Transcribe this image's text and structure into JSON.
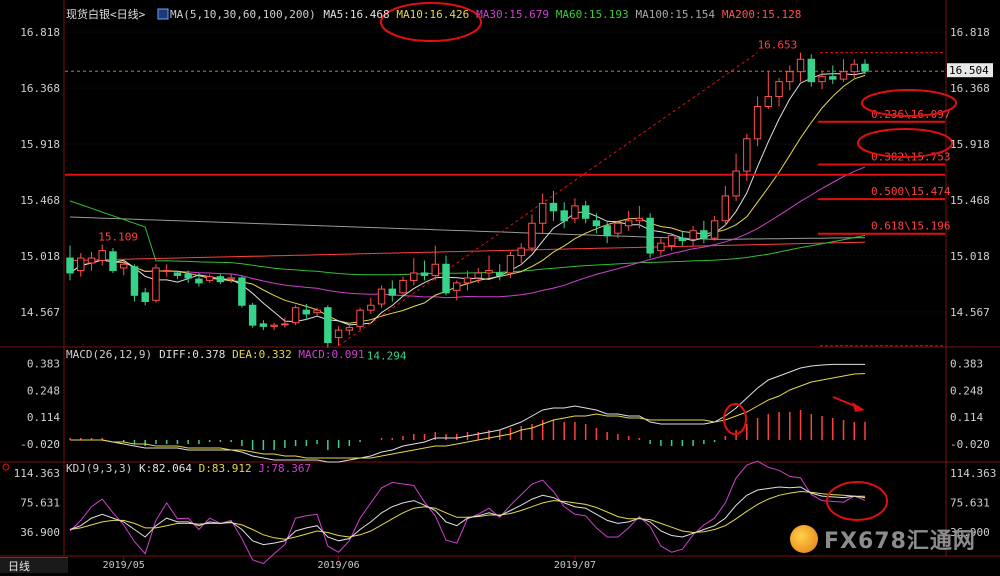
{
  "top_label": "现货白银<日线>",
  "ma_legend": [
    {
      "label": "MA(5,10,30,60,100,200)",
      "color": "#d0d0d0"
    },
    {
      "label": "MA5:16.468",
      "color": "#e0e0e0"
    },
    {
      "label": "MA10:16.426",
      "color": "#e6d84a"
    },
    {
      "label": "MA30:15.679",
      "color": "#d040d0"
    },
    {
      "label": "MA60:15.193",
      "color": "#3ccc3c"
    },
    {
      "label": "MA100:15.154",
      "color": "#a8a8a8"
    },
    {
      "label": "MA200:15.128",
      "color": "#ff5050"
    }
  ],
  "macd_legend": [
    {
      "label": "MACD(26,12,9)",
      "color": "#d0d0d0"
    },
    {
      "label": "DIFF:0.378",
      "color": "#e0e0e0"
    },
    {
      "label": "DEA:0.332",
      "color": "#e6d84a"
    },
    {
      "label": "MACD:0.091",
      "color": "#d040d0"
    }
  ],
  "kdj_legend": [
    {
      "label": "KDJ(9,3,3)",
      "color": "#d0d0d0"
    },
    {
      "label": "K:82.064",
      "color": "#e0e0e0"
    },
    {
      "label": "D:83.912",
      "color": "#e6d84a"
    },
    {
      "label": "J:78.367",
      "color": "#d040d0"
    }
  ],
  "bottom_tab": "日线",
  "watermark": "FX678汇通网",
  "chart_data": [
    {
      "type": "candlestick",
      "name": "price",
      "ylim": [
        14.3,
        16.9
      ],
      "y_ticks": [
        "16.818",
        "16.368",
        "15.918",
        "15.468",
        "15.018",
        "14.567"
      ],
      "y_tick_values": [
        16.818,
        16.368,
        15.918,
        15.468,
        15.018,
        14.567
      ],
      "x_ticks": [
        "2019/05",
        "2019/06",
        "2019/07"
      ],
      "x_tick_index": [
        5,
        25,
        47
      ],
      "annotations": [
        {
          "text": "16.653",
          "x": 64,
          "y": 16.653
        },
        {
          "text": "15.109",
          "x": 3,
          "y": 15.109
        },
        {
          "text": "14.294",
          "x": 28,
          "y": 14.294
        }
      ],
      "current_price": "16.504",
      "current_price_value": 16.504,
      "fibonacci": [
        {
          "label": "0.236\\16.097",
          "value": 16.097
        },
        {
          "label": "0.382\\15.753",
          "value": 15.753
        },
        {
          "label": "0.500\\15.474",
          "value": 15.474
        },
        {
          "label": "0.618\\15.196",
          "value": 15.196
        }
      ],
      "horizontal_lines": [
        15.67
      ],
      "candles": [
        {
          "o": 15.0,
          "h": 15.1,
          "l": 14.82,
          "c": 14.88
        },
        {
          "o": 14.9,
          "h": 15.04,
          "l": 14.85,
          "c": 15.0
        },
        {
          "o": 14.96,
          "h": 15.05,
          "l": 14.9,
          "c": 15.0
        },
        {
          "o": 14.98,
          "h": 15.109,
          "l": 14.94,
          "c": 15.06
        },
        {
          "o": 15.05,
          "h": 15.08,
          "l": 14.88,
          "c": 14.9
        },
        {
          "o": 14.92,
          "h": 14.98,
          "l": 14.86,
          "c": 14.95
        },
        {
          "o": 14.93,
          "h": 14.95,
          "l": 14.65,
          "c": 14.7
        },
        {
          "o": 14.72,
          "h": 14.76,
          "l": 14.62,
          "c": 14.65
        },
        {
          "o": 14.66,
          "h": 14.95,
          "l": 14.64,
          "c": 14.92
        },
        {
          "o": 14.9,
          "h": 14.95,
          "l": 14.85,
          "c": 14.9
        },
        {
          "o": 14.88,
          "h": 14.9,
          "l": 14.83,
          "c": 14.86
        },
        {
          "o": 14.87,
          "h": 14.9,
          "l": 14.8,
          "c": 14.84
        },
        {
          "o": 14.83,
          "h": 14.88,
          "l": 14.77,
          "c": 14.8
        },
        {
          "o": 14.82,
          "h": 14.87,
          "l": 14.8,
          "c": 14.85
        },
        {
          "o": 14.85,
          "h": 14.87,
          "l": 14.79,
          "c": 14.81
        },
        {
          "o": 14.83,
          "h": 14.87,
          "l": 14.8,
          "c": 14.84
        },
        {
          "o": 14.84,
          "h": 14.86,
          "l": 14.6,
          "c": 14.62
        },
        {
          "o": 14.62,
          "h": 14.64,
          "l": 14.44,
          "c": 14.46
        },
        {
          "o": 14.47,
          "h": 14.5,
          "l": 14.42,
          "c": 14.45
        },
        {
          "o": 14.45,
          "h": 14.48,
          "l": 14.42,
          "c": 14.46
        },
        {
          "o": 14.47,
          "h": 14.52,
          "l": 14.44,
          "c": 14.47
        },
        {
          "o": 14.48,
          "h": 14.62,
          "l": 14.46,
          "c": 14.6
        },
        {
          "o": 14.58,
          "h": 14.63,
          "l": 14.5,
          "c": 14.55
        },
        {
          "o": 14.56,
          "h": 14.6,
          "l": 14.53,
          "c": 14.58
        },
        {
          "o": 14.6,
          "h": 14.62,
          "l": 14.28,
          "c": 14.32
        },
        {
          "o": 14.36,
          "h": 14.45,
          "l": 14.294,
          "c": 14.42
        },
        {
          "o": 14.42,
          "h": 14.48,
          "l": 14.38,
          "c": 14.44
        },
        {
          "o": 14.45,
          "h": 14.6,
          "l": 14.42,
          "c": 14.58
        },
        {
          "o": 14.58,
          "h": 14.68,
          "l": 14.55,
          "c": 14.62
        },
        {
          "o": 14.63,
          "h": 14.78,
          "l": 14.6,
          "c": 14.75
        },
        {
          "o": 14.75,
          "h": 14.82,
          "l": 14.65,
          "c": 14.7
        },
        {
          "o": 14.72,
          "h": 14.85,
          "l": 14.7,
          "c": 14.82
        },
        {
          "o": 14.82,
          "h": 15.0,
          "l": 14.78,
          "c": 14.88
        },
        {
          "o": 14.88,
          "h": 14.98,
          "l": 14.82,
          "c": 14.86
        },
        {
          "o": 14.86,
          "h": 15.1,
          "l": 14.82,
          "c": 14.95
        },
        {
          "o": 14.95,
          "h": 15.02,
          "l": 14.7,
          "c": 14.72
        },
        {
          "o": 14.74,
          "h": 14.82,
          "l": 14.66,
          "c": 14.8
        },
        {
          "o": 14.8,
          "h": 14.9,
          "l": 14.74,
          "c": 14.84
        },
        {
          "o": 14.84,
          "h": 14.92,
          "l": 14.8,
          "c": 14.88
        },
        {
          "o": 14.88,
          "h": 15.02,
          "l": 14.84,
          "c": 14.9
        },
        {
          "o": 14.88,
          "h": 14.95,
          "l": 14.82,
          "c": 14.86
        },
        {
          "o": 14.88,
          "h": 15.05,
          "l": 14.84,
          "c": 15.02
        },
        {
          "o": 15.02,
          "h": 15.12,
          "l": 14.96,
          "c": 15.08
        },
        {
          "o": 15.08,
          "h": 15.35,
          "l": 15.05,
          "c": 15.28
        },
        {
          "o": 15.28,
          "h": 15.52,
          "l": 15.2,
          "c": 15.44
        },
        {
          "o": 15.44,
          "h": 15.54,
          "l": 15.3,
          "c": 15.38
        },
        {
          "o": 15.38,
          "h": 15.45,
          "l": 15.24,
          "c": 15.3
        },
        {
          "o": 15.32,
          "h": 15.48,
          "l": 15.28,
          "c": 15.42
        },
        {
          "o": 15.42,
          "h": 15.46,
          "l": 15.28,
          "c": 15.32
        },
        {
          "o": 15.3,
          "h": 15.36,
          "l": 15.2,
          "c": 15.26
        },
        {
          "o": 15.26,
          "h": 15.3,
          "l": 15.12,
          "c": 15.18
        },
        {
          "o": 15.2,
          "h": 15.3,
          "l": 15.16,
          "c": 15.28
        },
        {
          "o": 15.26,
          "h": 15.38,
          "l": 15.22,
          "c": 15.3
        },
        {
          "o": 15.3,
          "h": 15.42,
          "l": 15.24,
          "c": 15.32
        },
        {
          "o": 15.32,
          "h": 15.36,
          "l": 15.0,
          "c": 15.04
        },
        {
          "o": 15.06,
          "h": 15.16,
          "l": 15.02,
          "c": 15.12
        },
        {
          "o": 15.1,
          "h": 15.2,
          "l": 15.06,
          "c": 15.18
        },
        {
          "o": 15.16,
          "h": 15.22,
          "l": 15.1,
          "c": 15.14
        },
        {
          "o": 15.15,
          "h": 15.26,
          "l": 15.1,
          "c": 15.22
        },
        {
          "o": 15.22,
          "h": 15.3,
          "l": 15.12,
          "c": 15.16
        },
        {
          "o": 15.16,
          "h": 15.34,
          "l": 15.14,
          "c": 15.3
        },
        {
          "o": 15.3,
          "h": 15.58,
          "l": 15.26,
          "c": 15.5
        },
        {
          "o": 15.5,
          "h": 15.84,
          "l": 15.46,
          "c": 15.7
        },
        {
          "o": 15.7,
          "h": 16.0,
          "l": 15.62,
          "c": 15.96
        },
        {
          "o": 15.96,
          "h": 16.3,
          "l": 15.9,
          "c": 16.22
        },
        {
          "o": 16.22,
          "h": 16.5,
          "l": 16.2,
          "c": 16.3
        },
        {
          "o": 16.3,
          "h": 16.45,
          "l": 16.22,
          "c": 16.42
        },
        {
          "o": 16.42,
          "h": 16.55,
          "l": 16.35,
          "c": 16.5
        },
        {
          "o": 16.5,
          "h": 16.653,
          "l": 16.42,
          "c": 16.6
        },
        {
          "o": 16.6,
          "h": 16.64,
          "l": 16.38,
          "c": 16.42
        },
        {
          "o": 16.42,
          "h": 16.5,
          "l": 16.36,
          "c": 16.46
        },
        {
          "o": 16.46,
          "h": 16.55,
          "l": 16.4,
          "c": 16.44
        },
        {
          "o": 16.44,
          "h": 16.6,
          "l": 16.42,
          "c": 16.5
        },
        {
          "o": 16.5,
          "h": 16.6,
          "l": 16.45,
          "c": 16.56
        },
        {
          "o": 16.56,
          "h": 16.6,
          "l": 16.48,
          "c": 16.504
        }
      ]
    },
    {
      "type": "macd",
      "name": "MACD",
      "ylim": [
        -0.1,
        0.45
      ],
      "y_ticks": [
        "0.383",
        "0.248",
        "0.114",
        "-0.020"
      ],
      "y_tick_values": [
        0.383,
        0.248,
        0.114,
        -0.02
      ],
      "hist": [
        0.01,
        0.01,
        0.01,
        0.01,
        0.0,
        -0.01,
        -0.02,
        -0.03,
        -0.02,
        -0.02,
        -0.02,
        -0.02,
        -0.02,
        -0.01,
        -0.01,
        -0.01,
        -0.03,
        -0.05,
        -0.05,
        -0.05,
        -0.04,
        -0.03,
        -0.03,
        -0.02,
        -0.05,
        -0.04,
        -0.03,
        -0.01,
        0.0,
        0.01,
        0.01,
        0.02,
        0.03,
        0.03,
        0.04,
        0.03,
        0.03,
        0.04,
        0.04,
        0.05,
        0.05,
        0.06,
        0.07,
        0.08,
        0.1,
        0.1,
        0.09,
        0.09,
        0.08,
        0.06,
        0.04,
        0.03,
        0.02,
        0.01,
        -0.02,
        -0.03,
        -0.03,
        -0.03,
        -0.03,
        -0.02,
        -0.01,
        0.02,
        0.05,
        0.08,
        0.11,
        0.13,
        0.14,
        0.14,
        0.15,
        0.13,
        0.12,
        0.11,
        0.1,
        0.09,
        0.091
      ],
      "diff": [
        0.0,
        0.0,
        0.0,
        0.0,
        -0.01,
        -0.02,
        -0.03,
        -0.04,
        -0.04,
        -0.04,
        -0.04,
        -0.05,
        -0.05,
        -0.05,
        -0.05,
        -0.05,
        -0.06,
        -0.08,
        -0.09,
        -0.1,
        -0.1,
        -0.1,
        -0.1,
        -0.1,
        -0.11,
        -0.11,
        -0.1,
        -0.09,
        -0.08,
        -0.06,
        -0.05,
        -0.03,
        -0.02,
        -0.01,
        0.01,
        0.01,
        0.01,
        0.02,
        0.03,
        0.04,
        0.05,
        0.07,
        0.09,
        0.12,
        0.15,
        0.16,
        0.16,
        0.17,
        0.16,
        0.15,
        0.13,
        0.13,
        0.12,
        0.12,
        0.09,
        0.08,
        0.08,
        0.08,
        0.08,
        0.08,
        0.09,
        0.12,
        0.16,
        0.21,
        0.26,
        0.3,
        0.32,
        0.34,
        0.36,
        0.37,
        0.375,
        0.378,
        0.378,
        0.378,
        0.378
      ],
      "dea": [
        0.0,
        0.0,
        0.0,
        0.0,
        -0.01,
        -0.01,
        -0.02,
        -0.02,
        -0.03,
        -0.03,
        -0.03,
        -0.04,
        -0.04,
        -0.04,
        -0.04,
        -0.05,
        -0.05,
        -0.06,
        -0.07,
        -0.07,
        -0.08,
        -0.08,
        -0.09,
        -0.09,
        -0.09,
        -0.09,
        -0.09,
        -0.09,
        -0.09,
        -0.08,
        -0.07,
        -0.06,
        -0.05,
        -0.04,
        -0.03,
        -0.03,
        -0.02,
        -0.01,
        0.0,
        0.01,
        0.02,
        0.03,
        0.05,
        0.06,
        0.08,
        0.1,
        0.11,
        0.12,
        0.12,
        0.13,
        0.12,
        0.12,
        0.11,
        0.11,
        0.1,
        0.1,
        0.1,
        0.1,
        0.1,
        0.1,
        0.09,
        0.1,
        0.12,
        0.14,
        0.17,
        0.2,
        0.22,
        0.25,
        0.27,
        0.29,
        0.3,
        0.31,
        0.32,
        0.33,
        0.332
      ]
    },
    {
      "type": "kdj",
      "name": "KDJ",
      "ylim": [
        5,
        125
      ],
      "y_ticks": [
        "114.363",
        "75.631",
        "36.900"
      ],
      "y_tick_values": [
        114.363,
        75.631,
        36.9
      ],
      "k": [
        40,
        45,
        55,
        60,
        55,
        50,
        40,
        30,
        45,
        55,
        50,
        50,
        45,
        50,
        48,
        50,
        40,
        25,
        20,
        22,
        25,
        38,
        42,
        45,
        30,
        25,
        28,
        40,
        50,
        62,
        70,
        75,
        78,
        72,
        65,
        50,
        45,
        55,
        58,
        62,
        58,
        65,
        72,
        80,
        85,
        82,
        75,
        70,
        68,
        60,
        52,
        48,
        50,
        55,
        50,
        38,
        32,
        30,
        35,
        40,
        45,
        55,
        72,
        85,
        92,
        94,
        96,
        95,
        96,
        88,
        84,
        83,
        82,
        84,
        82
      ],
      "d": [
        40,
        42,
        46,
        50,
        52,
        52,
        48,
        42,
        42,
        45,
        48,
        48,
        47,
        48,
        48,
        49,
        46,
        40,
        33,
        29,
        27,
        30,
        34,
        38,
        36,
        32,
        30,
        33,
        38,
        46,
        54,
        62,
        68,
        70,
        68,
        62,
        56,
        56,
        57,
        59,
        59,
        61,
        65,
        70,
        75,
        78,
        77,
        75,
        73,
        69,
        63,
        57,
        54,
        54,
        53,
        48,
        43,
        38,
        36,
        37,
        40,
        45,
        54,
        64,
        73,
        80,
        85,
        88,
        90,
        89,
        87,
        86,
        85,
        84,
        83.9
      ],
      "j": [
        38,
        52,
        70,
        80,
        62,
        46,
        24,
        8,
        52,
        75,
        54,
        55,
        40,
        55,
        48,
        52,
        28,
        0,
        -5,
        8,
        20,
        55,
        58,
        60,
        18,
        10,
        25,
        55,
        75,
        95,
        102,
        100,
        98,
        76,
        58,
        26,
        22,
        54,
        60,
        68,
        56,
        72,
        86,
        100,
        105,
        90,
        70,
        60,
        58,
        42,
        30,
        30,
        42,
        57,
        44,
        18,
        10,
        14,
        33,
        46,
        55,
        75,
        108,
        125,
        130,
        122,
        118,
        110,
        108,
        86,
        78,
        77,
        76,
        84,
        78.4
      ]
    }
  ]
}
